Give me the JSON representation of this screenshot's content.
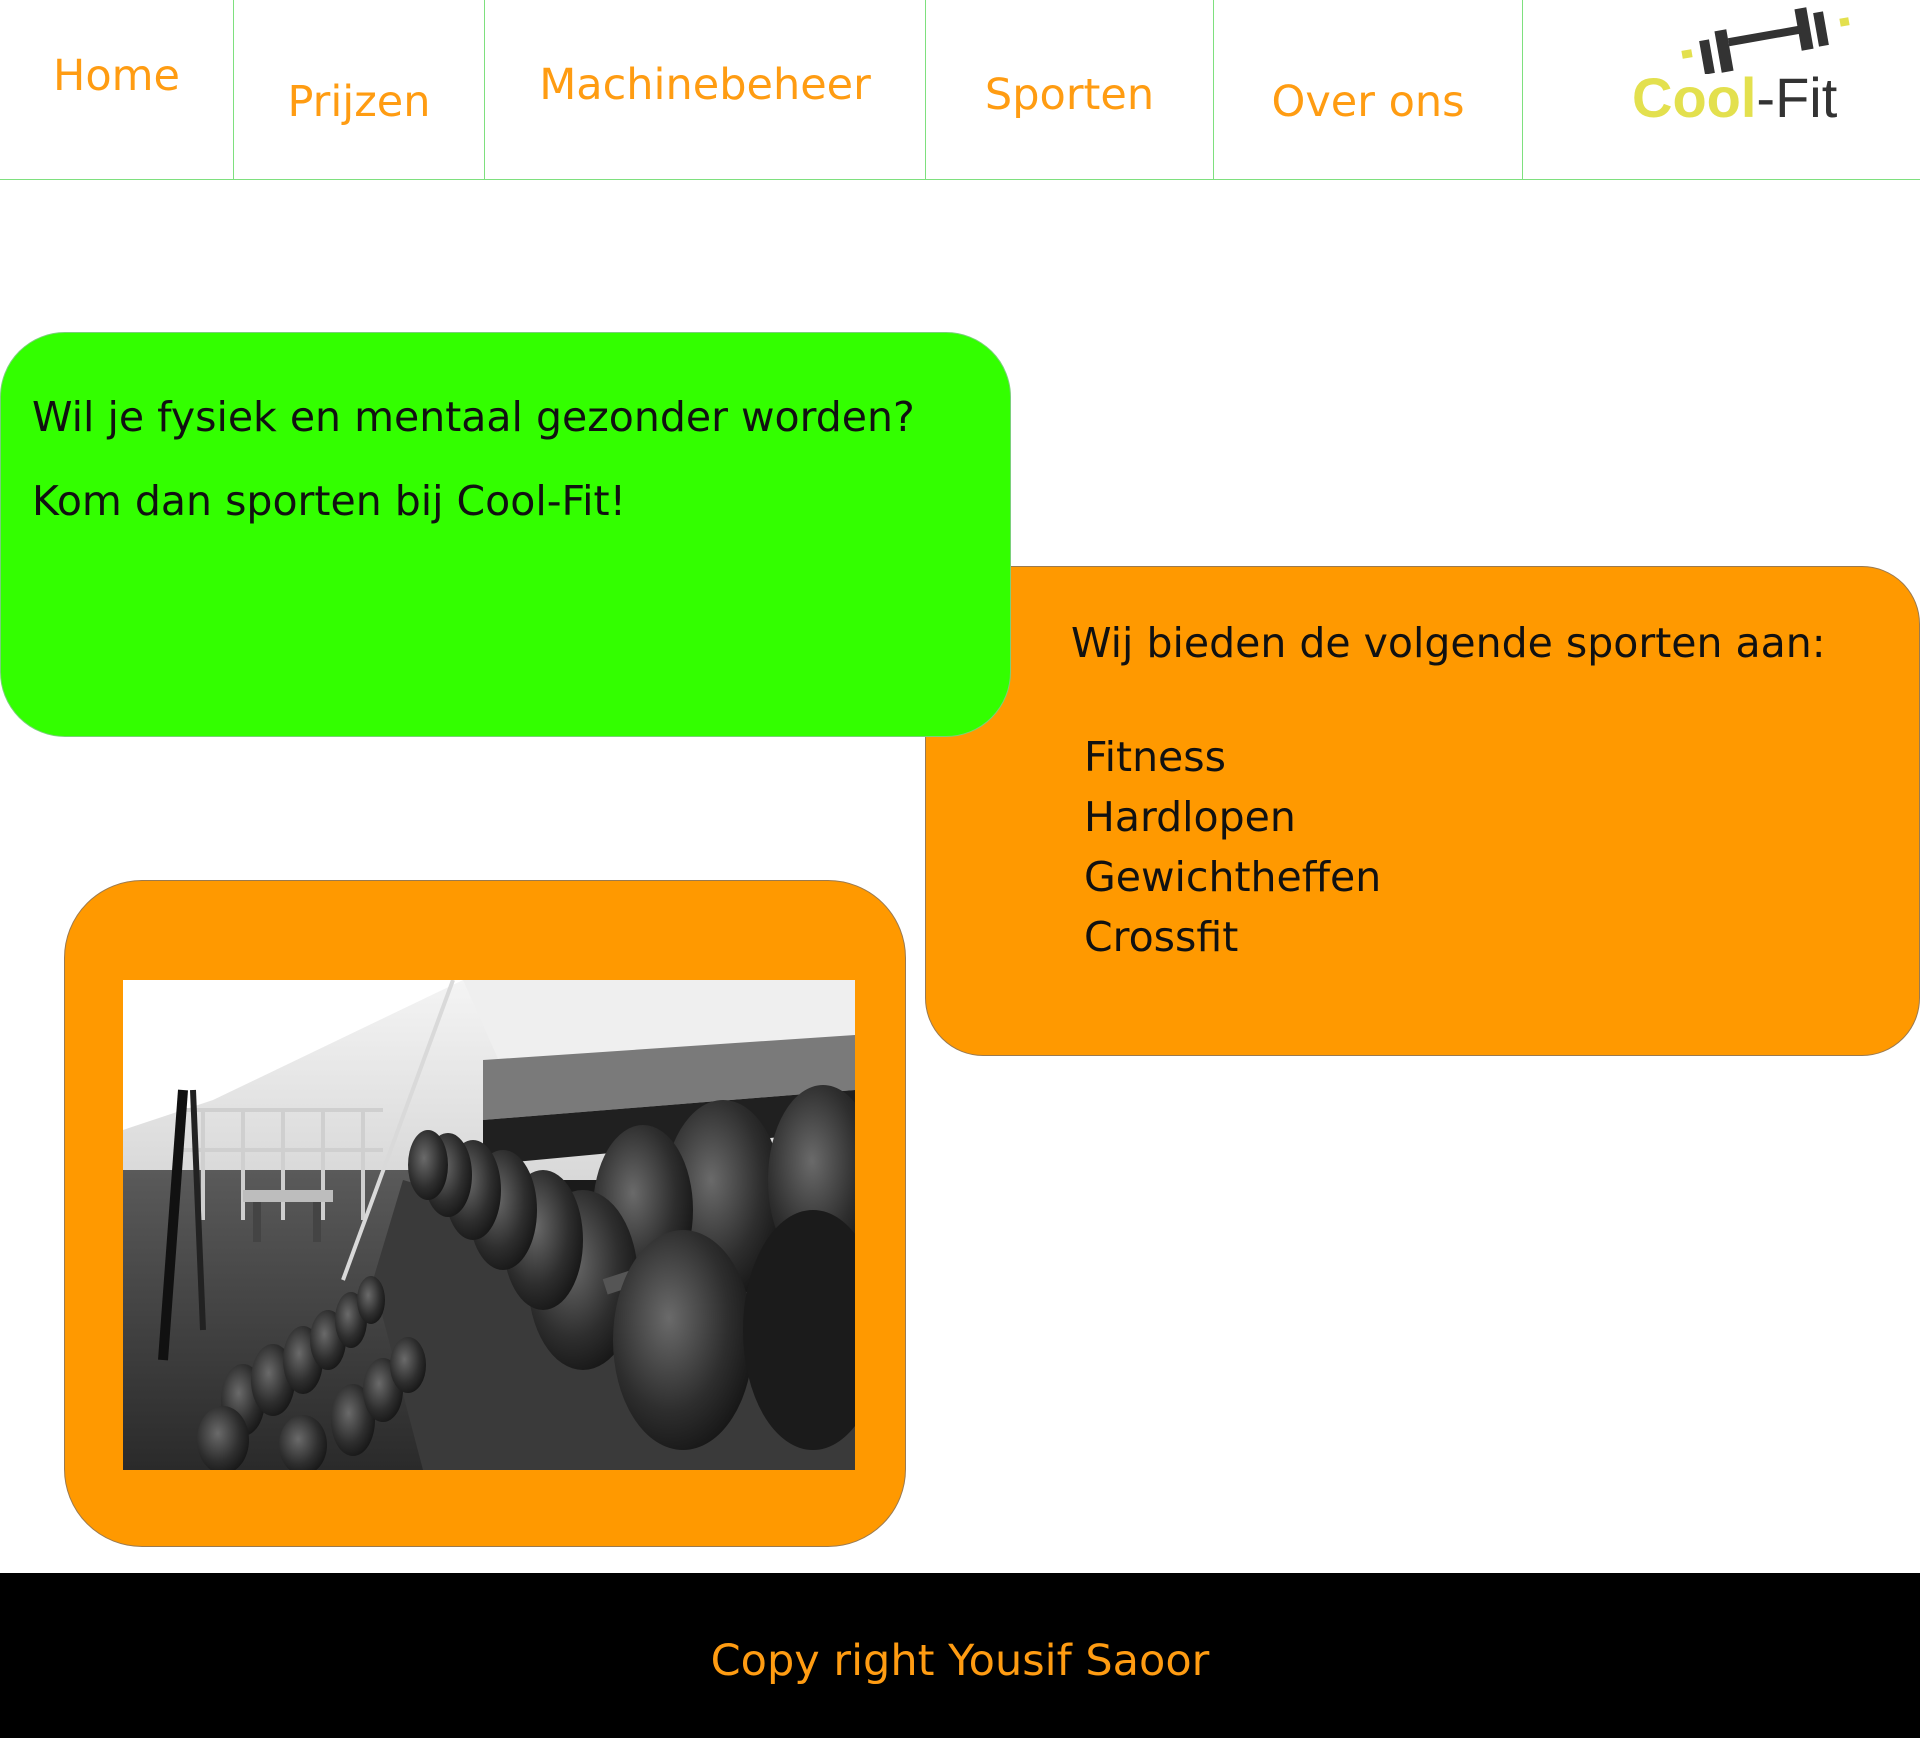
{
  "nav": {
    "items": [
      {
        "label": "Home"
      },
      {
        "label": "Prijzen"
      },
      {
        "label": "Machinebeheer"
      },
      {
        "label": "Sporten"
      },
      {
        "label": "Over ons"
      }
    ]
  },
  "logo": {
    "cool": "Cool",
    "fit": "-Fit",
    "icon": "barbell-icon"
  },
  "intro": {
    "line1": "Wil je fysiek en mentaal gezonder worden?",
    "line2": "Kom dan sporten bij Cool-Fit!"
  },
  "sports": {
    "intro": "Wij bieden de volgende sporten aan:",
    "items": [
      "Fitness",
      "Hardlopen",
      "Gewichtheffen",
      "Crossfit"
    ]
  },
  "photo": {
    "description_icon": "gym-dumbbell-rack-photo"
  },
  "footer": {
    "text": "Copy right Yousif Saoor"
  },
  "colors": {
    "accent_orange": "#ff9900",
    "nav_text": "#ff9c12",
    "green": "#33ff00",
    "logo_yellow": "#e3e04e",
    "footer_bg": "#000000"
  }
}
